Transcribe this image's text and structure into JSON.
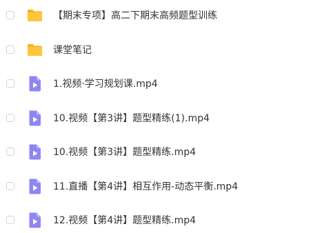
{
  "colors": {
    "folder": "#ffc53d",
    "folder_back": "#f5b21a",
    "video_file": "#8e86f3",
    "video_play": "#ffffff",
    "text": "#333333",
    "checkbox_border": "#cfd3d9"
  },
  "files": [
    {
      "type": "folder",
      "icon": "folder-icon",
      "name": "【期末专项】高二下期末高频题型训练"
    },
    {
      "type": "folder",
      "icon": "folder-icon",
      "name": "课堂笔记"
    },
    {
      "type": "video",
      "icon": "video-file-icon",
      "name": "1.视频·学习规划课.mp4"
    },
    {
      "type": "video",
      "icon": "video-file-icon",
      "name": "10.视频【第3讲】题型精练(1).mp4"
    },
    {
      "type": "video",
      "icon": "video-file-icon",
      "name": "10.视频【第3讲】题型精练.mp4"
    },
    {
      "type": "video",
      "icon": "video-file-icon",
      "name": "11.直播【第4讲】相互作用-动态平衡.mp4"
    },
    {
      "type": "video",
      "icon": "video-file-icon",
      "name": "12.视频【第4讲】题型精练.mp4"
    }
  ]
}
